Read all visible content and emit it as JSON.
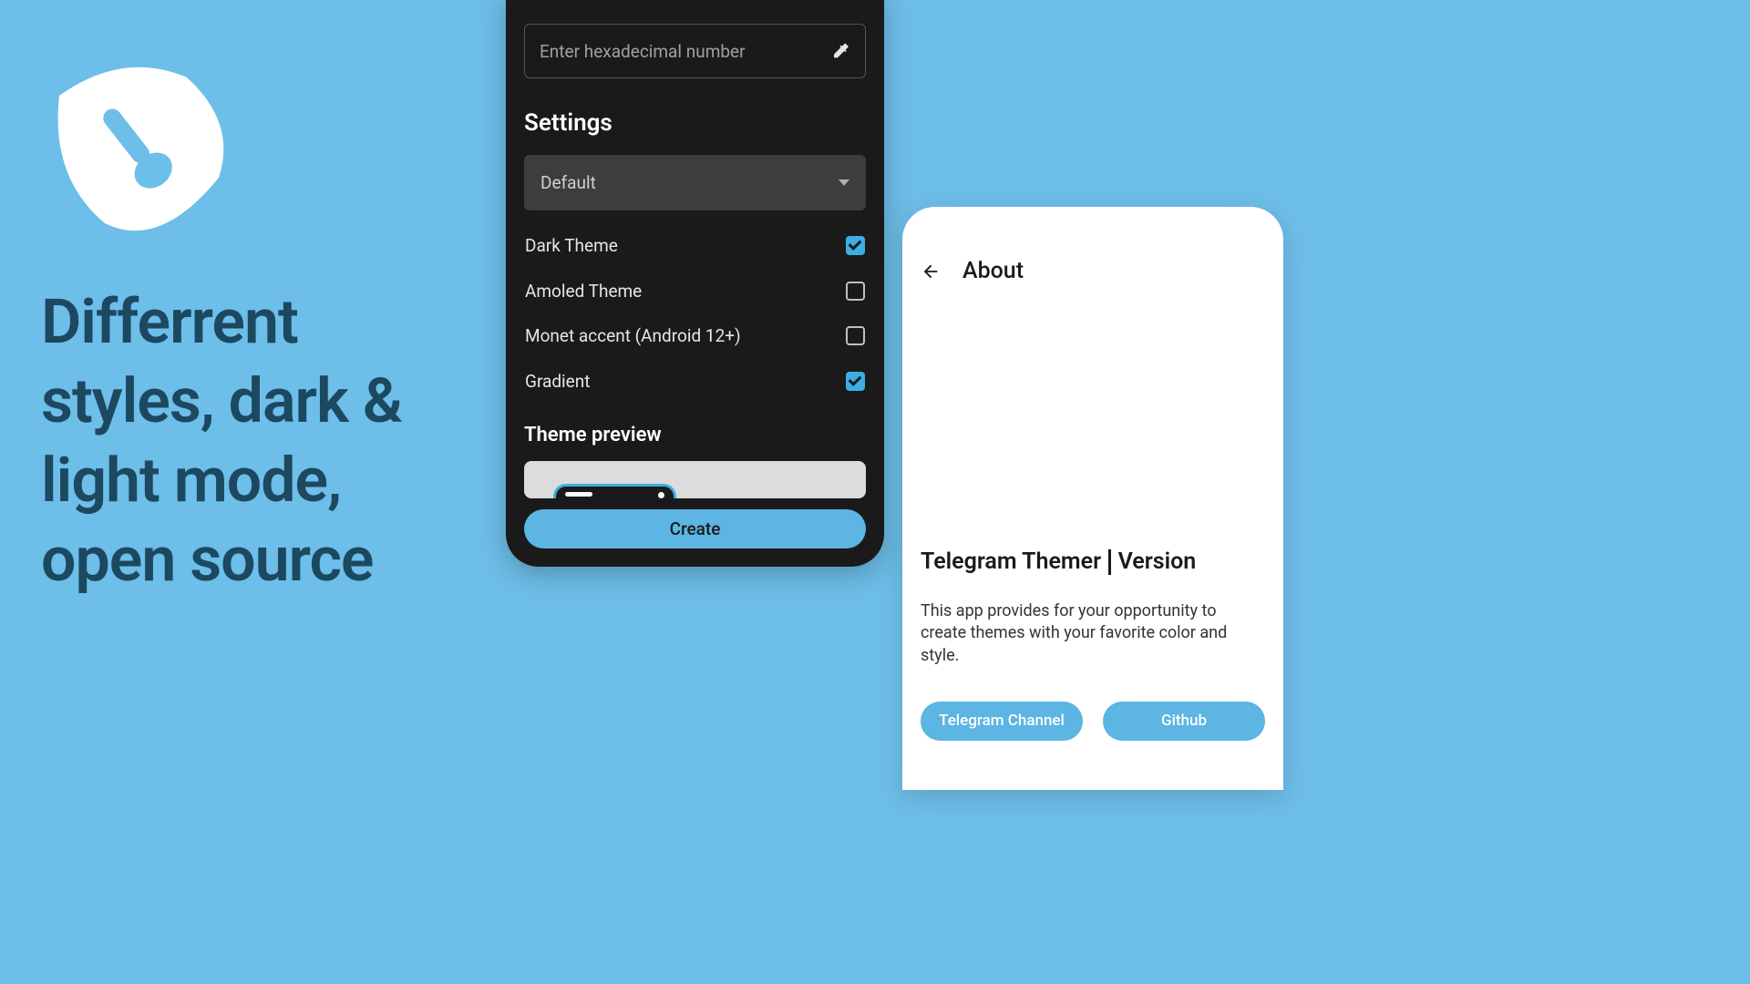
{
  "promo": {
    "tagline": "Differrent styles, dark & light mode, open source"
  },
  "phone_dark": {
    "hex_placeholder": "Enter hexadecimal number",
    "settings_heading": "Settings",
    "select_value": "Default",
    "options": [
      {
        "label": "Dark Theme",
        "checked": true
      },
      {
        "label": "Amoled Theme",
        "checked": false
      },
      {
        "label": "Monet accent (Android 12+)",
        "checked": false
      },
      {
        "label": "Gradient",
        "checked": true
      }
    ],
    "preview_heading": "Theme preview",
    "create_label": "Create"
  },
  "phone_light": {
    "title": "About",
    "app_name": "Telegram Themer",
    "version_label": "Version",
    "description": "This app provides for your opportunity to create themes with your favorite color and style.",
    "buttons": {
      "channel": "Telegram Channel",
      "github": "Github"
    }
  },
  "colors": {
    "accent": "#5cb5e2",
    "bg": "#6dbee9"
  }
}
